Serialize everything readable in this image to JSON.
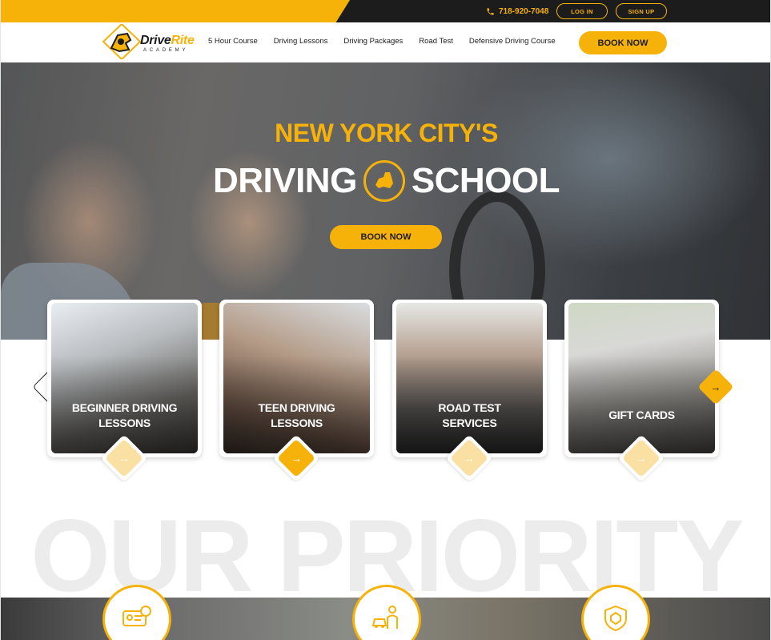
{
  "topbar": {
    "phone": "718-920-7048",
    "login_label": "LOG IN",
    "signup_label": "SIGN UP"
  },
  "brand": {
    "name_a": "Drive",
    "name_b": "Rite",
    "tagline": "ACADEMY",
    "accent": "#f7b20a",
    "dark": "#1c1c1c"
  },
  "nav": {
    "links": [
      "5 Hour Course",
      "Driving Lessons",
      "Driving Packages",
      "Road Test",
      "Defensive Driving Course"
    ],
    "book_label": "BOOK NOW"
  },
  "hero": {
    "line1": "NEW YORK CITY'S",
    "line2a": "DRIVING",
    "line2b": "SCHOOL",
    "book_label": "BOOK NOW"
  },
  "cards": [
    {
      "line1": "BEGINNER DRIVING",
      "line2": "LESSONS"
    },
    {
      "line1": "TEEN DRIVING",
      "line2": "LESSONS"
    },
    {
      "line1": "ROAD TEST",
      "line2": "SERVICES"
    },
    {
      "line1": "GIFT CARDS",
      "line2": ""
    }
  ],
  "priority": {
    "heading": "OUR PRIORITY"
  },
  "icons": {
    "phone": "phone-icon",
    "prev": "arrow-left-icon",
    "next": "arrow-right-icon",
    "card_arrow": "arrow-right-icon",
    "features": [
      "license-card-icon",
      "driver-car-icon",
      "shield-badge-icon"
    ]
  }
}
